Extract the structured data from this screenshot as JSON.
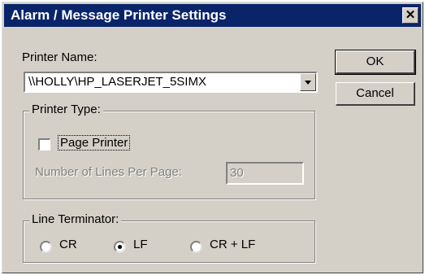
{
  "window": {
    "title": "Alarm / Message Printer Settings",
    "close_glyph": "✕"
  },
  "printer_name": {
    "label": "Printer Name:",
    "value": "\\\\HOLLY\\HP_LASERJET_5SIMX"
  },
  "buttons": {
    "ok": "OK",
    "cancel": "Cancel"
  },
  "printer_type": {
    "legend": "Printer Type:",
    "page_printer_label": "Page Printer",
    "page_printer_checked": false,
    "lines_per_page_label": "Number of Lines Per Page:",
    "lines_per_page_value": "30"
  },
  "line_terminator": {
    "legend": "Line Terminator:",
    "options": [
      "CR",
      "LF",
      "CR + LF"
    ],
    "selected": "LF"
  },
  "colors": {
    "title_bar": "#0a246a",
    "dialog_face": "#d4d0c8"
  }
}
